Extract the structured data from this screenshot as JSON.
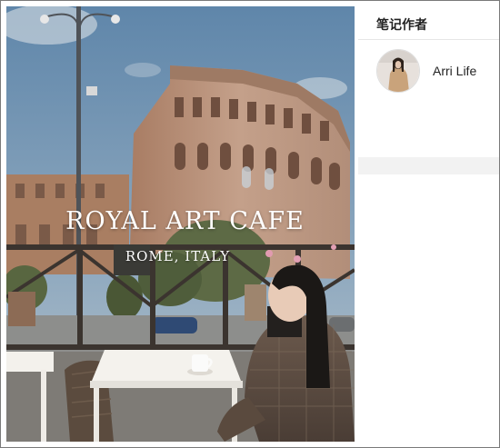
{
  "post_image": {
    "title": "ROYAL ART CAFE",
    "subtitle": "ROME, ITALY"
  },
  "author_panel": {
    "heading": "笔记作者",
    "author_name": "Arri Life"
  },
  "colors": {
    "sky": "#6f8fa8",
    "stone": "#b58d72",
    "panel_bg": "#f2f2f2",
    "card_bg": "#ffffff"
  },
  "icons": {
    "avatar": "user-avatar-photo"
  }
}
